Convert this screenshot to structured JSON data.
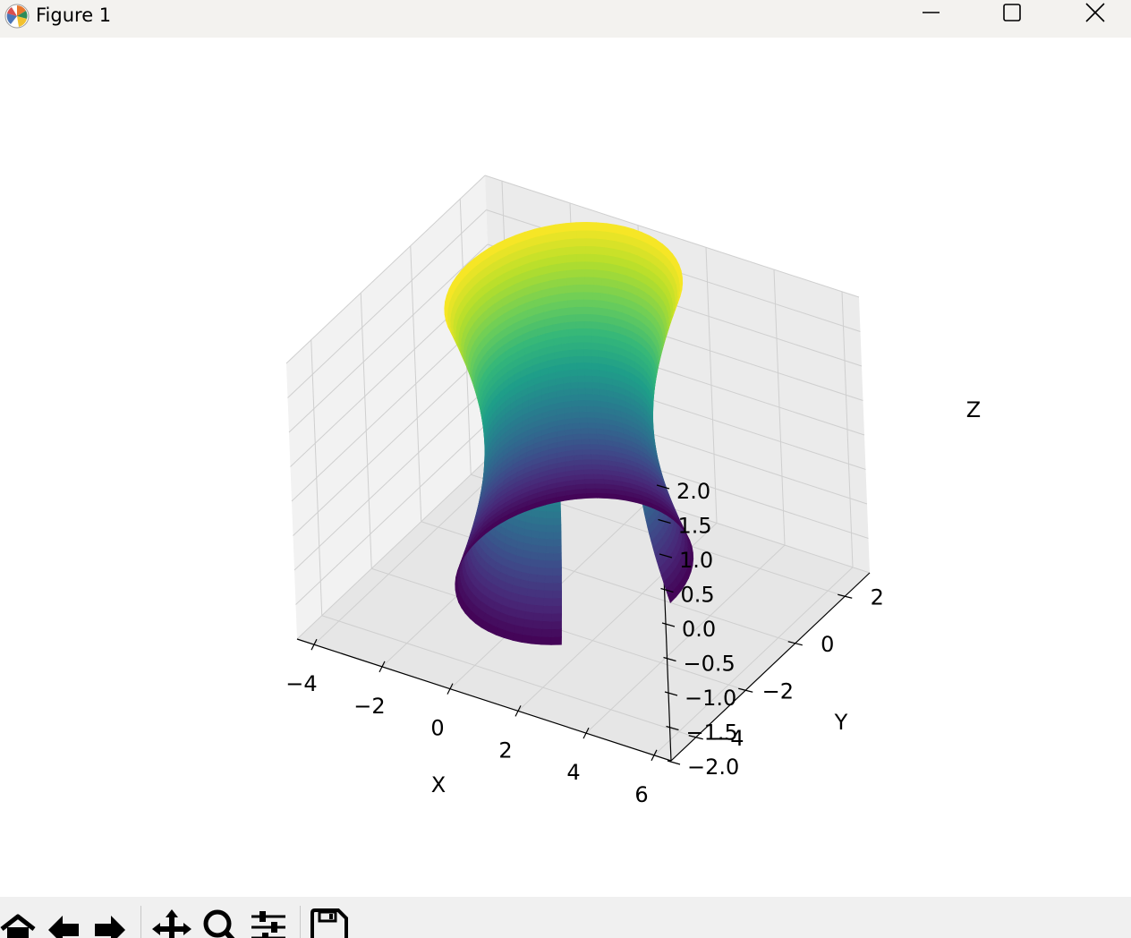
{
  "window": {
    "title": "Figure 1",
    "controls": [
      "minimize",
      "maximize",
      "close"
    ]
  },
  "toolbar": {
    "buttons": [
      {
        "name": "home",
        "icon": "home-icon"
      },
      {
        "name": "back",
        "icon": "back-arrow-icon"
      },
      {
        "name": "forward",
        "icon": "forward-arrow-icon"
      },
      {
        "name": "pan",
        "icon": "move-icon"
      },
      {
        "name": "zoom",
        "icon": "magnifier-icon"
      },
      {
        "name": "configure-subplots",
        "icon": "sliders-icon"
      },
      {
        "name": "save",
        "icon": "floppy-disk-icon"
      }
    ]
  },
  "chart_data": {
    "type": "surface3d",
    "surface": "ruled hyperboloid strip; radius r = sqrt(4 + z^2), angle from 0 to about 300 degrees",
    "colormap": "viridis",
    "color_value": "z",
    "xlabel": "X",
    "ylabel": "Y",
    "zlabel": "Z",
    "xlim": [
      -4.5,
      6.5
    ],
    "ylim": [
      -5,
      3
    ],
    "zlim": [
      -2,
      2
    ],
    "x_ticks": [
      "−4",
      "−2",
      "0",
      "2",
      "4",
      "6"
    ],
    "y_ticks": [
      "−4",
      "−2",
      "0",
      "2"
    ],
    "z_ticks": [
      "−2.0",
      "−1.5",
      "−1.0",
      "−0.5",
      "0.0",
      "0.5",
      "1.0",
      "1.5",
      "2.0"
    ],
    "grid": true
  }
}
